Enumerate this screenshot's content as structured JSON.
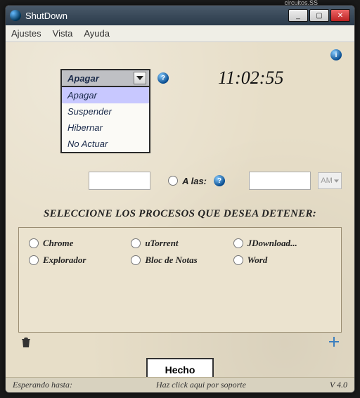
{
  "background_tab": "circuitos.SS",
  "window": {
    "title": "ShutDown",
    "controls": {
      "min": "_",
      "max": "▢",
      "close": "✕"
    }
  },
  "menubar": [
    "Ajustes",
    "Vista",
    "Ayuda"
  ],
  "action_dropdown": {
    "selected": "Apagar",
    "options": [
      "Apagar",
      "Suspender",
      "Hibernar",
      "No Actuar"
    ]
  },
  "clock": "11:02:55",
  "time_mode": {
    "at_label": "A las:",
    "ampm": "AM"
  },
  "section_title": "SELECCIONE LOS PROCESOS QUE DESEA DETENER:",
  "processes": [
    "Chrome",
    "uTorrent",
    "JDownload...",
    "Explorador",
    "Bloc de Notas",
    "Word"
  ],
  "done_button": "Hecho",
  "statusbar": {
    "left": "Esperando hasta:",
    "center": "Haz click aqui por soporte",
    "right": "V 4.0"
  }
}
